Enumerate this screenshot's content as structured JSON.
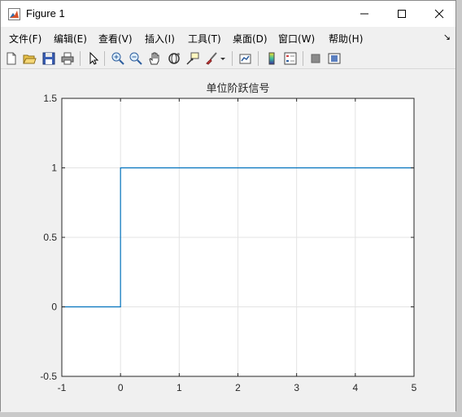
{
  "window": {
    "title": "Figure 1",
    "controls": {
      "minimize": "minimize",
      "maximize": "maximize",
      "close": "close"
    }
  },
  "menubar": {
    "items": [
      {
        "label": "文件(F)"
      },
      {
        "label": "编辑(E)"
      },
      {
        "label": "查看(V)"
      },
      {
        "label": "插入(I)"
      },
      {
        "label": "工具(T)"
      },
      {
        "label": "桌面(D)"
      },
      {
        "label": "窗口(W)"
      },
      {
        "label": "帮助(H)"
      }
    ],
    "overflow_icon": "arrow-icon"
  },
  "toolbar": {
    "buttons": [
      "new-figure-icon",
      "open-file-icon",
      "save-icon",
      "print-icon",
      "select-arrow-icon",
      "zoom-in-icon",
      "zoom-out-icon",
      "pan-hand-icon",
      "rotate-3d-icon",
      "data-cursor-icon",
      "brush-icon",
      "link-plot-icon",
      "insert-colorbar-icon",
      "insert-legend-icon",
      "hide-plot-tools-icon",
      "show-plot-tools-icon"
    ]
  },
  "chart_data": {
    "type": "line",
    "title": "单位阶跃信号",
    "xlabel": "",
    "ylabel": "",
    "xlim": [
      -1,
      5
    ],
    "ylim": [
      -0.5,
      1.5
    ],
    "xticks": [
      "-1",
      "0",
      "1",
      "2",
      "3",
      "4",
      "5"
    ],
    "yticks": [
      "-0.5",
      "0",
      "0.5",
      "1",
      "1.5"
    ],
    "grid": true,
    "series": [
      {
        "color": "#0072bd",
        "x": [
          -1,
          0,
          0,
          5
        ],
        "y": [
          0,
          0,
          1,
          1
        ]
      }
    ]
  }
}
